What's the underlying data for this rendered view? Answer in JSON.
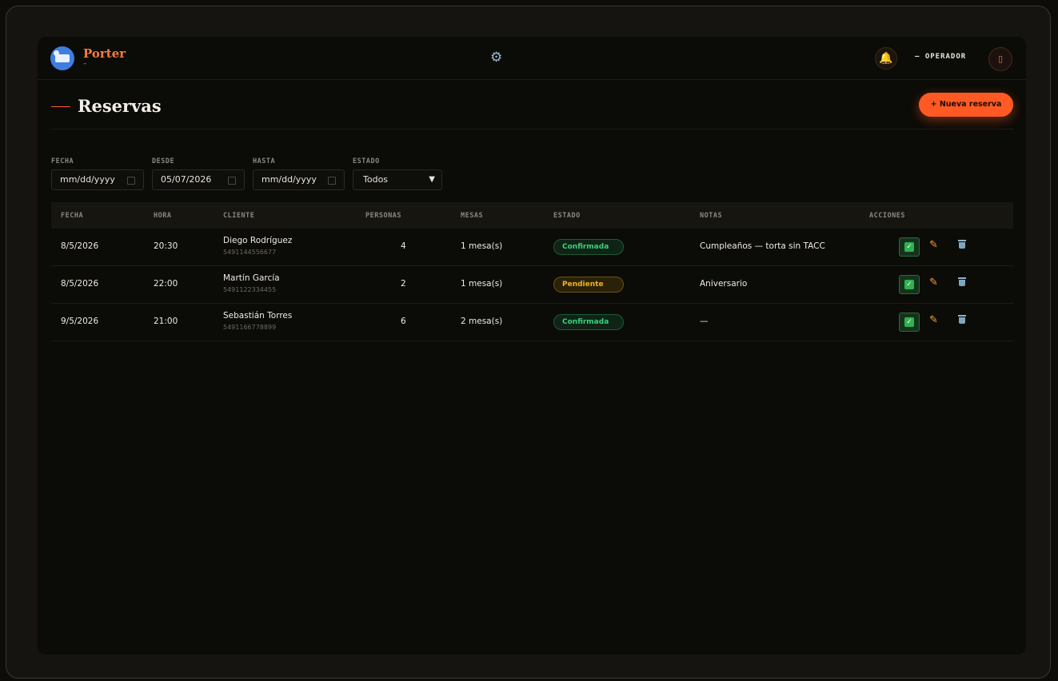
{
  "brand": {
    "name": "Porter",
    "subtitle": "–"
  },
  "header": {
    "settings_icon": "gear-icon",
    "notifications_icon": "bell-icon",
    "operator_label": "— OPERADOR",
    "logout_icon": "door-icon"
  },
  "page": {
    "title": "Reservas",
    "new_button": "+ Nueva reserva"
  },
  "filters": {
    "fecha": {
      "label": "FECHA",
      "value": "mm/dd/yyyy"
    },
    "desde": {
      "label": "DESDE",
      "value": "05/07/2026"
    },
    "hasta": {
      "label": "HASTA",
      "value": "mm/dd/yyyy"
    },
    "estado": {
      "label": "ESTADO",
      "value": "Todos"
    }
  },
  "table": {
    "columns": [
      "FECHA",
      "HORA",
      "CLIENTE",
      "PERSONAS",
      "MESAS",
      "ESTADO",
      "NOTAS",
      "ACCIONES"
    ],
    "rows": [
      {
        "fecha": "8/5/2026",
        "hora": "20:30",
        "cliente": "Diego Rodríguez",
        "telefono": "5491144556677",
        "personas": "4",
        "mesas": "1 mesa(s)",
        "estado": "Confirmada",
        "notas": "Cumpleaños — torta sin TACC"
      },
      {
        "fecha": "8/5/2026",
        "hora": "22:00",
        "cliente": "Martín García",
        "telefono": "5491122334455",
        "personas": "2",
        "mesas": "1 mesa(s)",
        "estado": "Pendiente",
        "notas": "Aniversario"
      },
      {
        "fecha": "9/5/2026",
        "hora": "21:00",
        "cliente": "Sebastián Torres",
        "telefono": "5491166778899",
        "personas": "6",
        "mesas": "2 mesa(s)",
        "estado": "Confirmada",
        "notas": "—"
      }
    ],
    "actions": {
      "confirm_icon": "check-icon",
      "edit_icon": "pencil-icon",
      "delete_icon": "trash-icon"
    }
  },
  "colors": {
    "accent": "#ff5a24",
    "confirmed": "#3ad27a",
    "pending": "#f0b321",
    "background": "#0b0b07"
  }
}
